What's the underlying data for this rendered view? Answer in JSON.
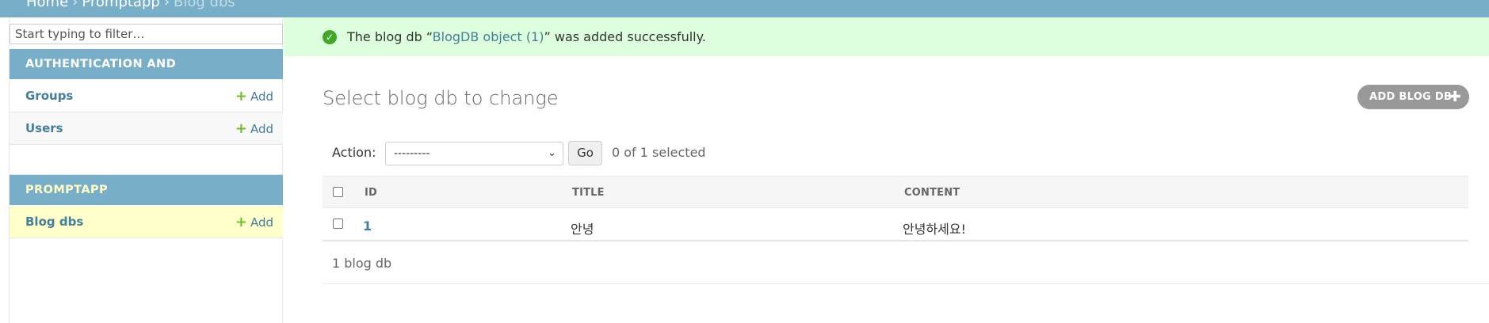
{
  "breadcrumbs": {
    "home": "Home",
    "separator": "›",
    "app": "Promptapp",
    "current": "Blog dbs"
  },
  "sidebar": {
    "filter_placeholder": "Start typing to filter…",
    "apps": [
      {
        "caption": "AUTHENTICATION AND AUTHORIZATION",
        "models": [
          {
            "name": "Groups",
            "add_label": "Add"
          },
          {
            "name": "Users",
            "add_label": "Add"
          }
        ]
      },
      {
        "caption": "PROMPTAPP",
        "models": [
          {
            "name": "Blog dbs",
            "add_label": "Add"
          }
        ]
      }
    ]
  },
  "message": {
    "prefix": "The blog db “",
    "link_text": "BlogDB object (1)",
    "suffix": "” was added successfully.",
    "icon": "check-circle-icon"
  },
  "main": {
    "title": "Select blog db to change",
    "add_button": "ADD BLOG DB",
    "add_icon": "plus-icon",
    "actions": {
      "label": "Action:",
      "selected_option": "---------",
      "go_label": "Go",
      "selected_count": "0 of 1 selected"
    },
    "table": {
      "columns": [
        "ID",
        "TITLE",
        "CONTENT"
      ],
      "rows": [
        {
          "id": "1",
          "title": "안녕",
          "content": "안녕하세요!"
        }
      ]
    },
    "paginator": "1 blog db"
  },
  "colors": {
    "header": "#79aec8",
    "link": "#447e9b",
    "success_bg": "#ddffdd",
    "add_green": "#70bf2b",
    "selected_row": "#ffffcc"
  }
}
